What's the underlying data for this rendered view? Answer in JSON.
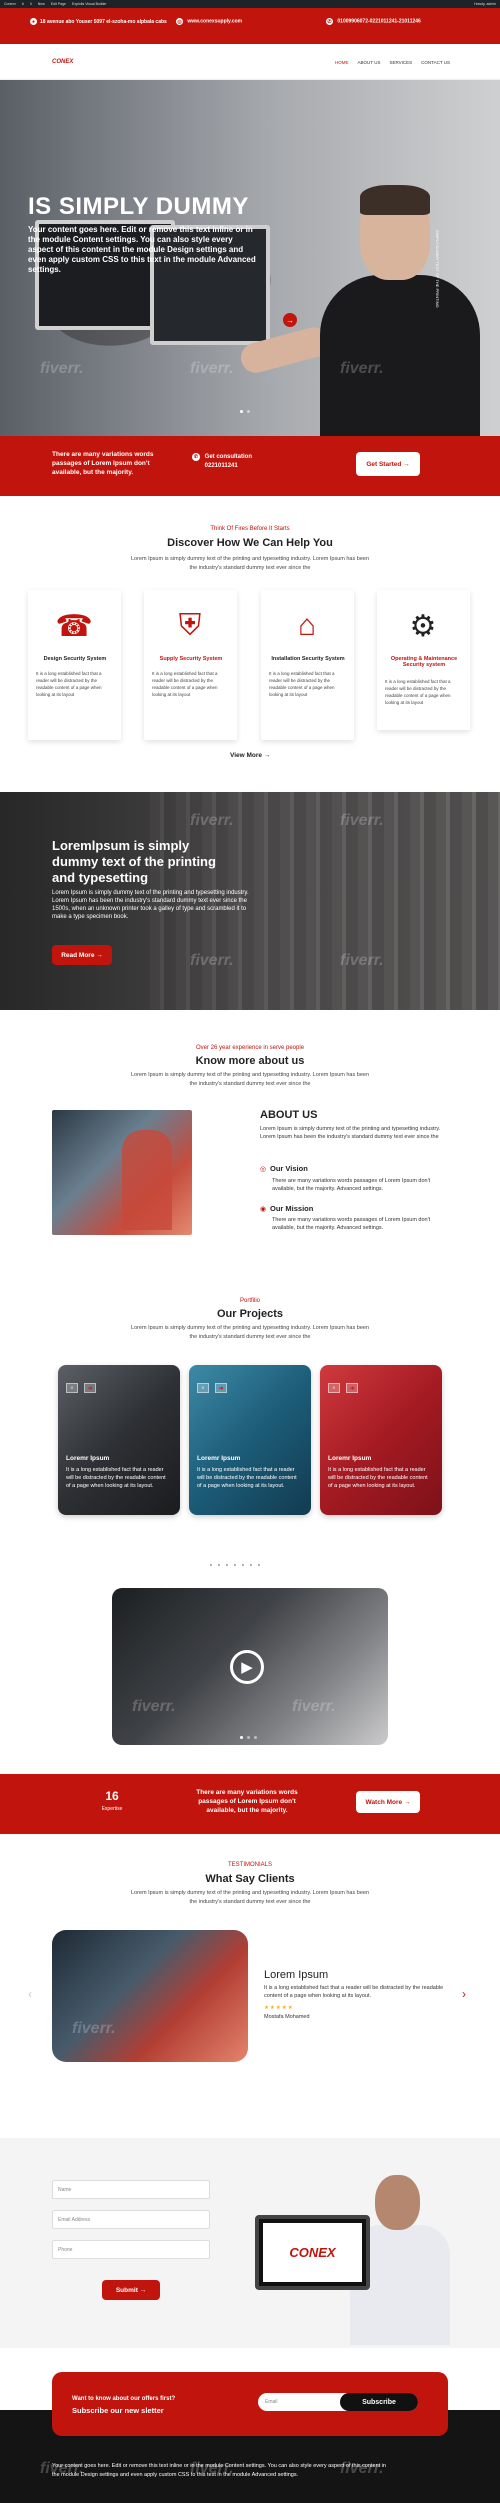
{
  "admin_bar": {
    "items": [
      "Conexx",
      "6",
      "0",
      "New",
      "Edit Page",
      "Exploits Visual Builder"
    ],
    "right": "Howdy, admin"
  },
  "top_info": {
    "address": "18 avenue abo Youser 5097 el-szoha-mo alpbala cabs",
    "email": "www.conexsupply.com",
    "phone": "01009906072-0221011241-21011246"
  },
  "nav": {
    "logo": "CONEX",
    "items": [
      "HOME",
      "ABOUT US",
      "SERVICES",
      "CONTACT US"
    ]
  },
  "hero": {
    "title": "IS SIMPLY DUMMY",
    "text": "Your content goes here. Edit or remove this text inline or in the module Content settings. You can also style every aspect of this content in the module Design settings and even apply custom CSS to this text in the module Advanced settings.",
    "vertical": "SIMPLY DUMMY TEXT OF THE PRINTING",
    "button": "→",
    "watermark": "fiverr."
  },
  "cta": {
    "text": "There are many variations words passages of Lorem Ipsum don't available, but the majority.",
    "phone_label": "Get consultation",
    "phone": "0221011241",
    "button": "Get Started →"
  },
  "services": {
    "sub": "Think Of Fires Before It Starts",
    "title": "Discover How We Can Help You",
    "desc": "Lorem Ipsum is simply dummy text of the printing and typesetting industry. Lorem Ipsum has been the industry's standard dummy text ever since the",
    "cards": [
      {
        "icon": "fire-alarm-icon",
        "glyph": "☎",
        "title": "Design Security System",
        "text": "It is a long established fact that a reader will be distracted by the readable content of a page when looking at its layout"
      },
      {
        "icon": "shield-hand-icon",
        "glyph": "⛨",
        "title": "Supply Security System",
        "text": "It is a long established fact that a reader will be distracted by the readable content of a page when looking at its layout"
      },
      {
        "icon": "building-alarm-icon",
        "glyph": "⌂",
        "title": "Installation Security System",
        "text": "It is a long established fact that a reader will be distracted by the readable content of a page when looking at its layout"
      },
      {
        "icon": "gears-icon",
        "glyph": "⚙",
        "title": "Operating & Maintenance Security system",
        "text": "It is a long established fact that a reader will be distracted by the readable content of a page when looking at its layout"
      }
    ],
    "view_more": "View More →"
  },
  "band": {
    "title": "Loremlpsum is simply dummy text of the printing and typesetting",
    "text": "Lorem Ipsum is simply dummy text of the printing and typesetting industry. Lorem Ipsum has been the industry's standard dummy text ever since the 1500s, when an unknown printer took a galley of type and scrambled it to make a type specimen book.",
    "button": "Read More →"
  },
  "about": {
    "sub": "Over 26 year experience in serve people",
    "title": "Know more about us",
    "desc": "Lorem Ipsum is simply dummy text of the printing and typesetting industry. Lorem Ipsum has been the industry's standard dummy text ever since the",
    "heading": "ABOUT US",
    "para": "Lorem Ipsum is simply dummy text of the printing and typesetting industry. Lorem Ipsum has been the industry's standard dummy text ever since the",
    "vision_title": "Our Vision",
    "vision_text": "There are many variations words passages of Lorem Ipsum don't available, but the majority. Advanced settings.",
    "mission_title": "Our Mission",
    "mission_text": "There are many variations words passages of Lorem Ipsum don't available, but the majority. Advanced settings."
  },
  "projects": {
    "sub": "Portfilio",
    "title": "Our Projects",
    "desc": "Lorem Ipsum is simply dummy text of the printing and typesetting industry. Lorem Ipsum has been the industry's standard dummy text ever since the",
    "items": [
      {
        "title": "Loremr Ipsum",
        "text": "It is a long established fact that a reader will be distracted by the readable content of a page when looking at its layout."
      },
      {
        "title": "Loremr Ipsum",
        "text": "It is a long established fact that a reader will be distracted by the readable content of a page when looking at its layout."
      },
      {
        "title": "Loremr Ipsum",
        "text": "It is a long established fact that a reader will be distracted by the readable content of a page when looking at its layout."
      }
    ],
    "colors": [
      "#2f3236",
      "#1e6a84",
      "#b2202a"
    ]
  },
  "stats": {
    "number": "16",
    "label": "Expertise",
    "text": "There are many variations words passages of Lorem Ipsum don't available, but the majority.",
    "button": "Watch More →"
  },
  "testimonials": {
    "sub": "TESTIMONIALS",
    "title": "What Say Clients",
    "desc": "Lorem Ipsum is simply dummy text of the printing and typesetting industry. Lorem Ipsum has been the industry's standard dummy text ever since the",
    "name": "Lorem Ipsum",
    "text": "It is a long established fact that a reader will be distracted by the readable content of a page when looking at its layout.",
    "stars": "★★★★★",
    "author": "Mostafa Mohamed",
    "prev": "‹",
    "next": "›"
  },
  "contact": {
    "name_placeholder": "Name",
    "email_placeholder": "Email Address",
    "phone_placeholder": "Phone",
    "button": "Submit →",
    "laptop_logo": "CONEX"
  },
  "newsletter": {
    "line1": "Want to know about our offers first?",
    "line2": "Subscribe our new sletter",
    "placeholder": "Email",
    "button": "Subscribe"
  },
  "footer": {
    "text": "Your content goes here. Edit or remove this text inline or in the module Content settings. You can also style every aspect of this content in the module Design settings and even apply custom CSS to this text in the module Advanced settings."
  },
  "colors": {
    "accent": "#c0140c",
    "dark": "#141414"
  }
}
